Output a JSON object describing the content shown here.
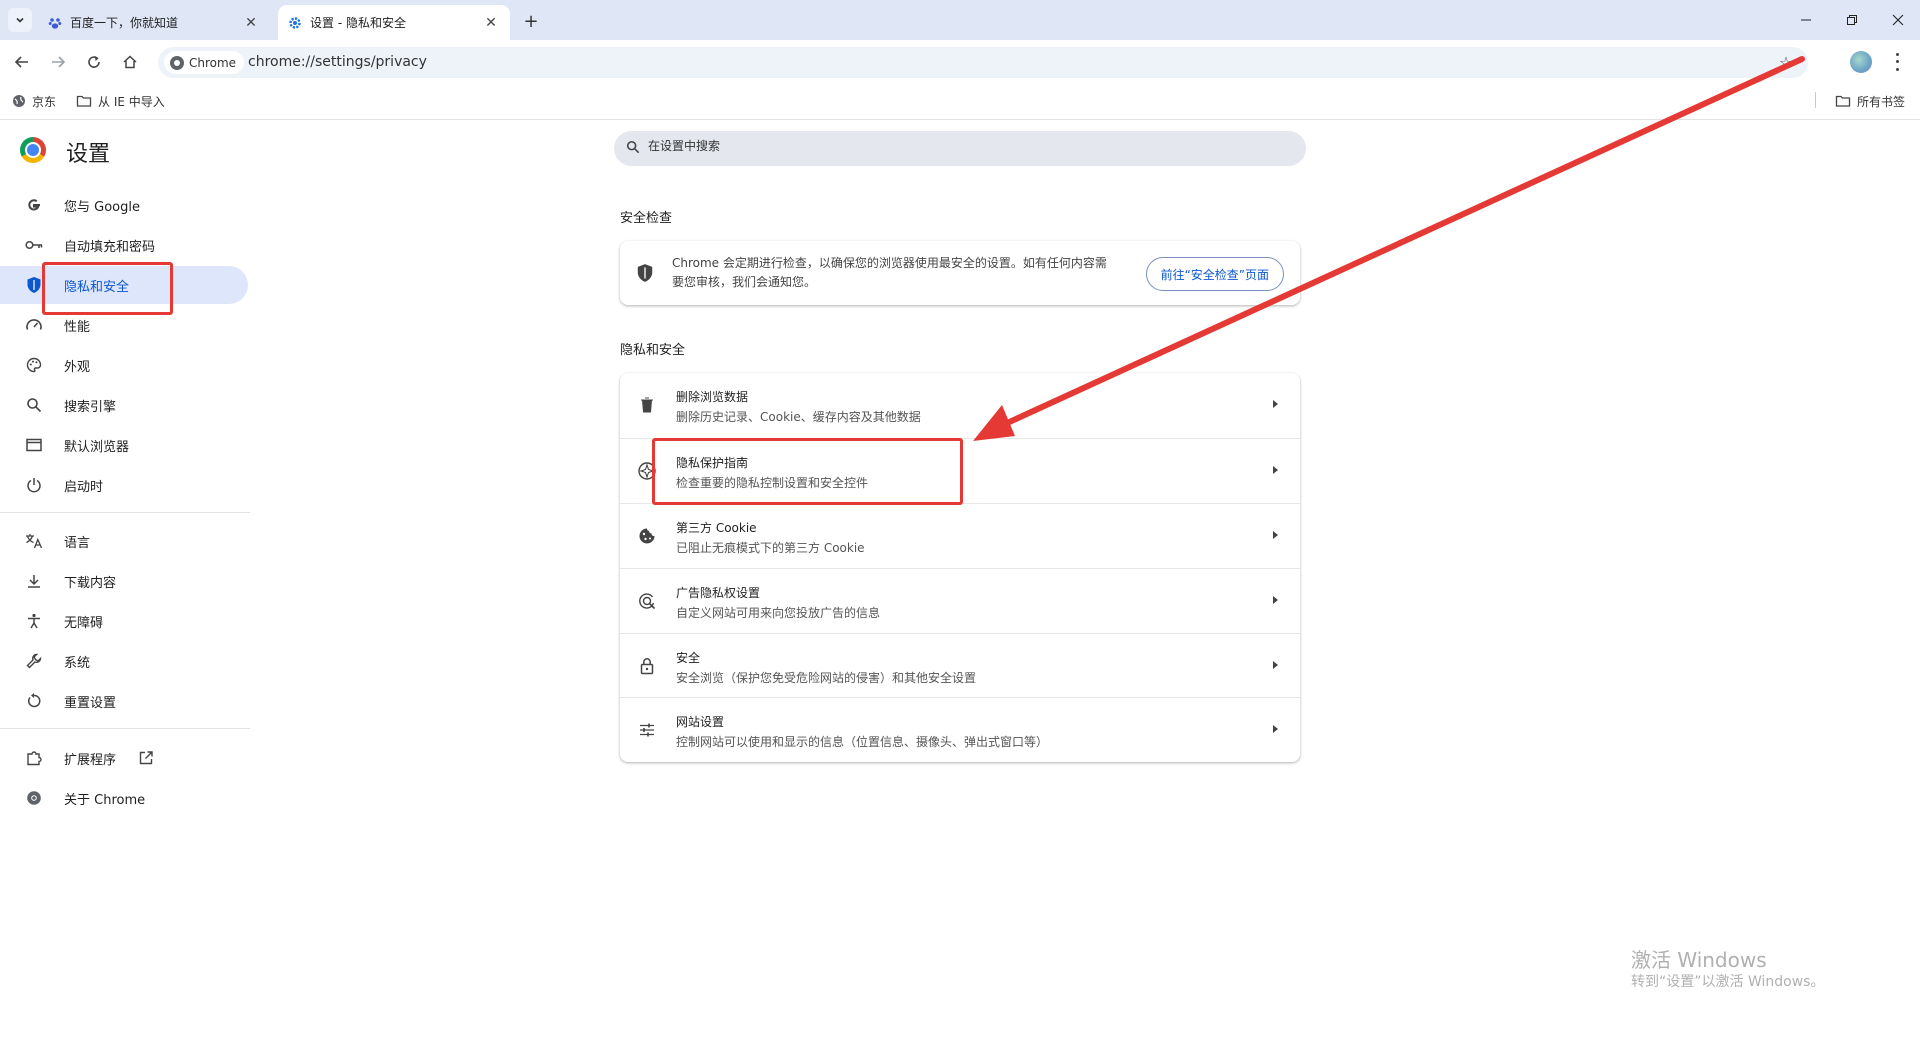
{
  "tabs": [
    {
      "title": "百度一下，你就知道",
      "icon": "baidu-paw-icon",
      "active": false
    },
    {
      "title": "设置 - 隐私和安全",
      "icon": "gear-icon",
      "active": true
    }
  ],
  "toolbar": {
    "chip_label": "Chrome",
    "url": "chrome://settings/privacy"
  },
  "bookmarks": [
    {
      "label": "京东",
      "icon": "globe-icon"
    },
    {
      "label": "从 IE 中导入",
      "icon": "folder-icon"
    }
  ],
  "bookmarks_all": "所有书签",
  "settings": {
    "title": "设置",
    "search_placeholder": "在设置中搜索"
  },
  "nav": [
    {
      "label": "您与 Google",
      "icon": "google-g-icon"
    },
    {
      "label": "自动填充和密码",
      "icon": "key-icon"
    },
    {
      "label": "隐私和安全",
      "icon": "shield-icon",
      "selected": true
    },
    {
      "label": "性能",
      "icon": "speedometer-icon"
    },
    {
      "label": "外观",
      "icon": "palette-icon"
    },
    {
      "label": "搜索引擎",
      "icon": "search-icon"
    },
    {
      "label": "默认浏览器",
      "icon": "browser-window-icon"
    },
    {
      "label": "启动时",
      "icon": "power-icon"
    },
    {
      "label": "语言",
      "icon": "translate-icon"
    },
    {
      "label": "下载内容",
      "icon": "download-icon"
    },
    {
      "label": "无障碍",
      "icon": "accessibility-icon"
    },
    {
      "label": "系统",
      "icon": "wrench-icon"
    },
    {
      "label": "重置设置",
      "icon": "reset-icon"
    },
    {
      "label": "扩展程序",
      "icon": "puzzle-icon"
    },
    {
      "label": "关于 Chrome",
      "icon": "chrome-icon"
    }
  ],
  "safety_check": {
    "section_title": "安全检查",
    "description": "Chrome 会定期进行检查，以确保您的浏览器使用最安全的设置。如有任何内容需要您审核，我们会通知您。",
    "button": "前往“安全检查”页面"
  },
  "privacy": {
    "section_title": "隐私和安全",
    "rows": [
      {
        "title": "删除浏览数据",
        "sub": "删除历史记录、Cookie、缓存内容及其他数据",
        "icon": "trash-icon"
      },
      {
        "title": "隐私保护指南",
        "sub": "检查重要的隐私控制设置和安全控件",
        "icon": "compass-icon"
      },
      {
        "title": "第三方 Cookie",
        "sub": "已阻止无痕模式下的第三方 Cookie",
        "icon": "cookie-icon"
      },
      {
        "title": "广告隐私权设置",
        "sub": "自定义网站可用来向您投放广告的信息",
        "icon": "ad-privacy-icon"
      },
      {
        "title": "安全",
        "sub": "安全浏览（保护您免受危险网站的侵害）和其他安全设置",
        "icon": "lock-icon"
      },
      {
        "title": "网站设置",
        "sub": "控制网站可以使用和显示的信息（位置信息、摄像头、弹出式窗口等）",
        "icon": "sliders-icon"
      }
    ]
  },
  "watermark": {
    "line1": "激活 Windows",
    "line2": "转到“设置”以激活 Windows。"
  },
  "colors": {
    "accent": "#0b57d0",
    "annotation": "#e53935",
    "selected_bg": "#dde6fb"
  }
}
